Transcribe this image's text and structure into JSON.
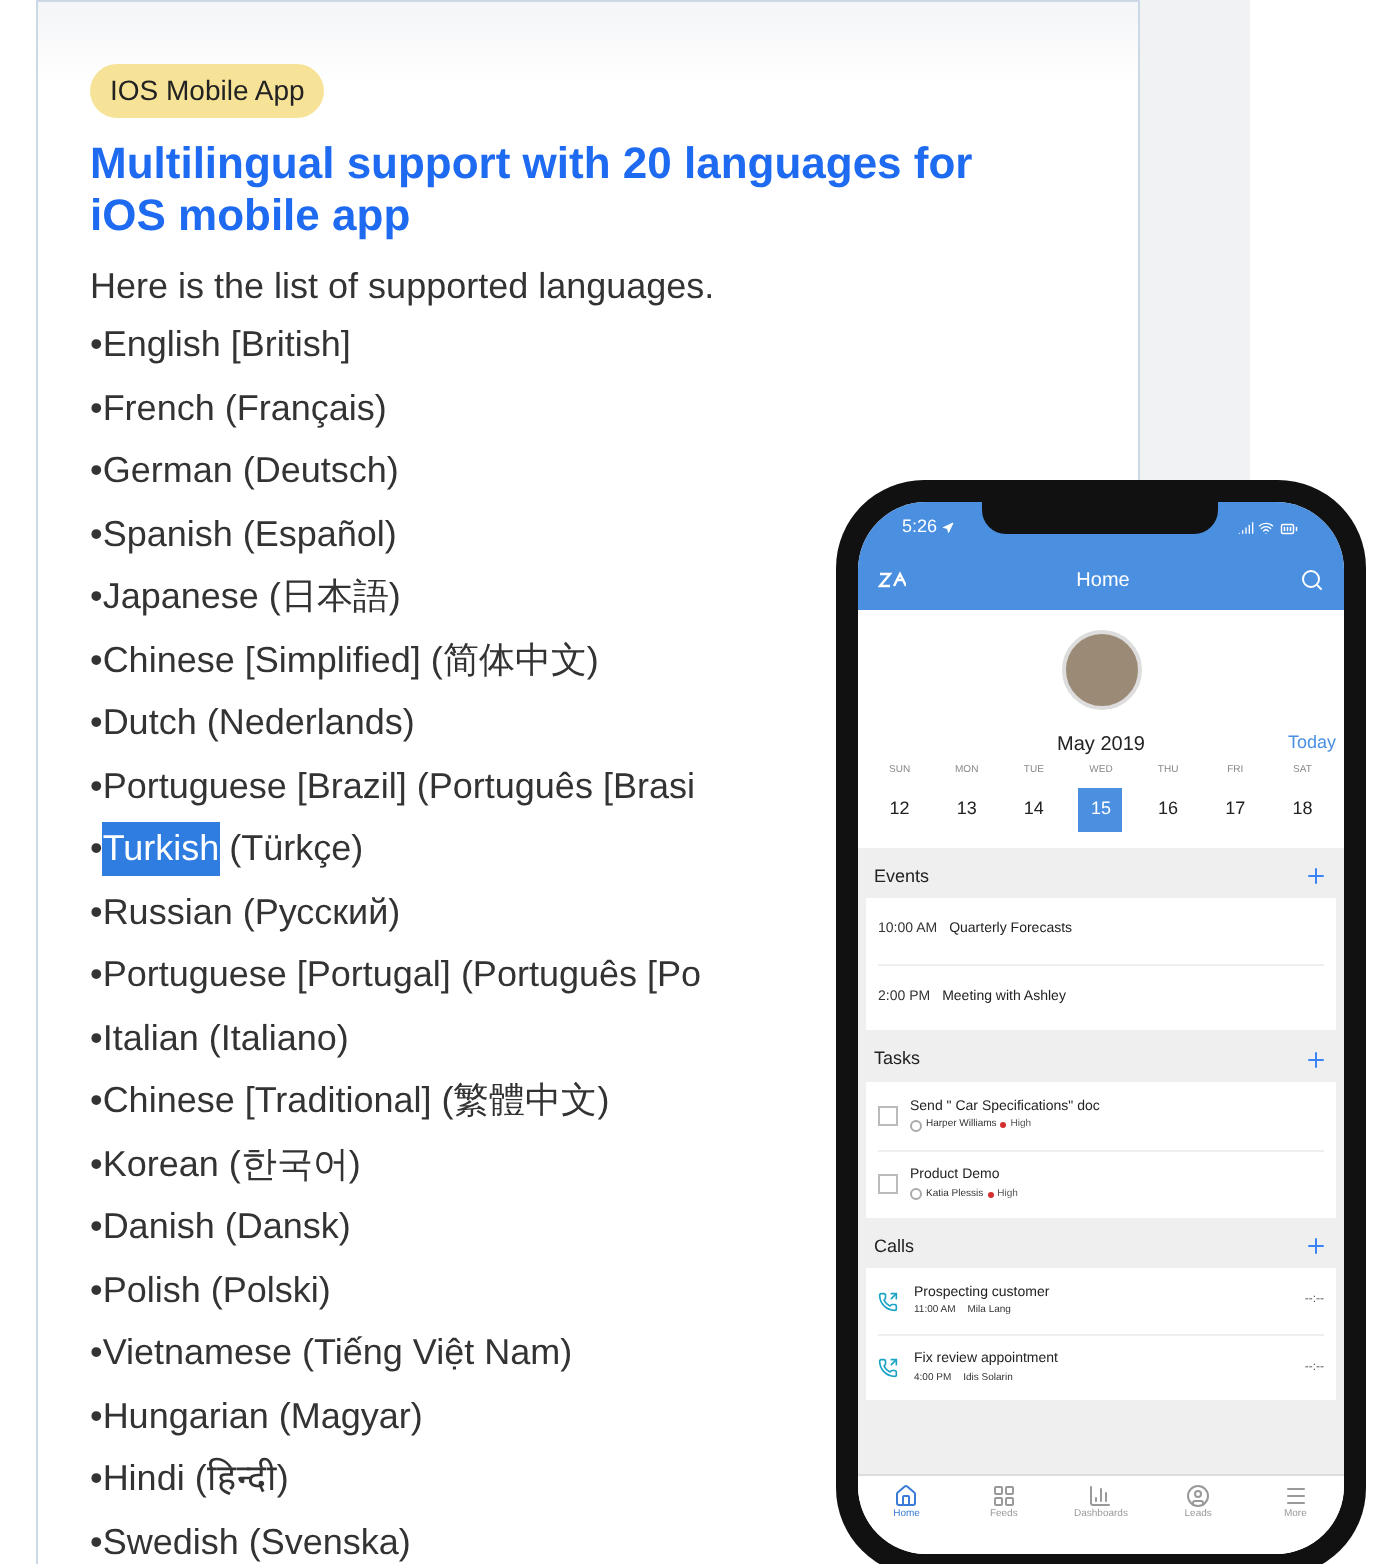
{
  "badge": "IOS Mobile App",
  "heading": "Multilingual support with 20 languages for iOS mobile app",
  "intro": "Here is the list of supported languages.",
  "languages": [
    {
      "marker": "•",
      "name": "English [British]",
      "selected": false
    },
    {
      "marker": "•",
      "name": "French",
      "native": "(Français)",
      "selected": false
    },
    {
      "marker": "•",
      "name": "German",
      "native": "(Deutsch)",
      "selected": false
    },
    {
      "marker": "•",
      "name": "Spanish",
      "native": "(Español)",
      "selected": false
    },
    {
      "marker": "•",
      "name": "Japanese",
      "native": "(日本語)",
      "selected": false
    },
    {
      "marker": "•",
      "name": "Chinese [Simplified]",
      "native": "(简体中文)",
      "selected": false
    },
    {
      "marker": "•",
      "name": "Dutch",
      "native": "(Nederlands)",
      "selected": false
    },
    {
      "marker": "•",
      "name": "Portuguese [Brazil]",
      "native": "(Português [Brasi",
      "selected": false
    },
    {
      "marker": "•",
      "name": "Turkish",
      "native": "(Türkçe)",
      "selected": true
    },
    {
      "marker": "•",
      "name": "Russian",
      "native": "(Русский)",
      "selected": false
    },
    {
      "marker": "•",
      "name": "Portuguese [Portugal]",
      "native": "(Português [Po",
      "selected": false
    },
    {
      "marker": "•",
      "name": "Italian",
      "native": "(Italiano)",
      "selected": false
    },
    {
      "marker": "•",
      "name": "Chinese [Traditional]",
      "native": "(繁體中文)",
      "selected": false
    },
    {
      "marker": "•",
      "name": "Korean",
      "native": "(한국어)",
      "selected": false
    },
    {
      "marker": "•",
      "name": "Danish",
      "native": "(Dansk)",
      "selected": false
    },
    {
      "marker": "•",
      "name": "Polish",
      "native": "(Polski)",
      "selected": false
    },
    {
      "marker": "•",
      "name": "Vietnamese",
      "native": "(Tiếng Việt Nam)",
      "selected": false
    },
    {
      "marker": "•",
      "name": "Hungarian",
      "native": "(Magyar)",
      "selected": false
    },
    {
      "marker": "•",
      "name": "Hindi",
      "native": "(हिन्दी)",
      "selected": false
    },
    {
      "marker": "•",
      "name": "Swedish",
      "native": "(Svenska)",
      "selected": false
    }
  ],
  "phone": {
    "status_time": "5:26",
    "header_title": "Home",
    "calendar": {
      "month": "May 2019",
      "today": "Today",
      "days": [
        {
          "weekday": "SUN",
          "date": "12",
          "selected": false
        },
        {
          "weekday": "MON",
          "date": "13",
          "selected": false
        },
        {
          "weekday": "TUE",
          "date": "14",
          "selected": false
        },
        {
          "weekday": "WED",
          "date": "15",
          "selected": true
        },
        {
          "weekday": "THU",
          "date": "16",
          "selected": false
        },
        {
          "weekday": "FRI",
          "date": "17",
          "selected": false
        },
        {
          "weekday": "SAT",
          "date": "18",
          "selected": false
        }
      ]
    },
    "events": {
      "title": "Events",
      "items": [
        {
          "time": "10:00 AM",
          "title": "Quarterly Forecasts"
        },
        {
          "time": "2:00 PM",
          "title": "Meeting with Ashley"
        }
      ]
    },
    "tasks": {
      "title": "Tasks",
      "items": [
        {
          "title": "Send \" Car Specifications\" doc",
          "owner": "Harper Williams",
          "priority": "High",
          "checked": false
        },
        {
          "title": "Product Demo",
          "owner": "Katia Plessis",
          "priority": "High",
          "checked": false
        }
      ]
    },
    "calls": {
      "title": "Calls",
      "items": [
        {
          "title": "Prospecting customer",
          "time": "11:00 AM",
          "contact": "Mila Lang",
          "duration": "--:--"
        },
        {
          "title": "Fix review appointment",
          "time": "4:00  PM",
          "contact": "Idis Solarin",
          "duration": "--:--"
        }
      ]
    },
    "tabs": [
      {
        "kind": "home",
        "label": "Home",
        "selected": true
      },
      {
        "kind": "feeds",
        "label": "Feeds",
        "selected": false
      },
      {
        "kind": "dashboards",
        "label": "Dashboards",
        "selected": false
      },
      {
        "kind": "leads",
        "label": "Leads",
        "selected": false
      },
      {
        "kind": "more",
        "label": "More",
        "selected": false
      }
    ]
  }
}
